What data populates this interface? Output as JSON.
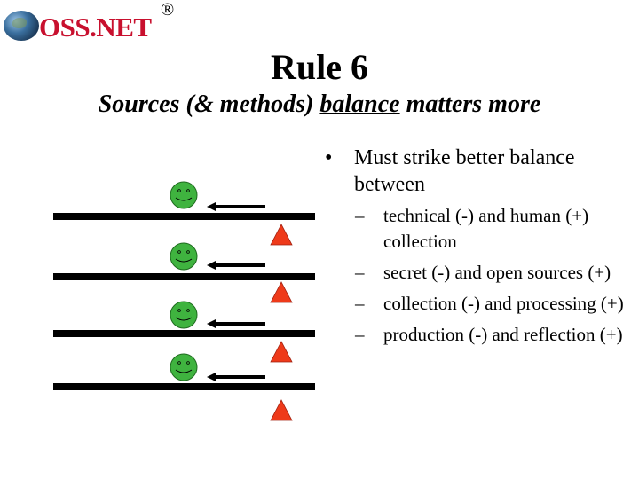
{
  "logo": {
    "text": "OSS.NET",
    "registered_mark": "®",
    "icon": "globe-icon",
    "brand_color": "#c8102e"
  },
  "slide": {
    "title": "Rule 6",
    "subtitle_before": "Sources (& methods) ",
    "subtitle_underlined": "balance",
    "subtitle_after": " matters more"
  },
  "diagram": {
    "rows": 4,
    "colors": {
      "smiley": "#3fb33f",
      "triangle": "#ee3a1a",
      "bar": "#000000",
      "arrow": "#000000"
    }
  },
  "bullets": {
    "main_marker": "•",
    "main": "Must strike better balance between",
    "sub_marker": "–",
    "subs": [
      "technical (-) and human (+) collection",
      "secret (-) and open sources (+)",
      "collection (-) and processing (+)",
      "production (-) and reflection (+)"
    ]
  }
}
